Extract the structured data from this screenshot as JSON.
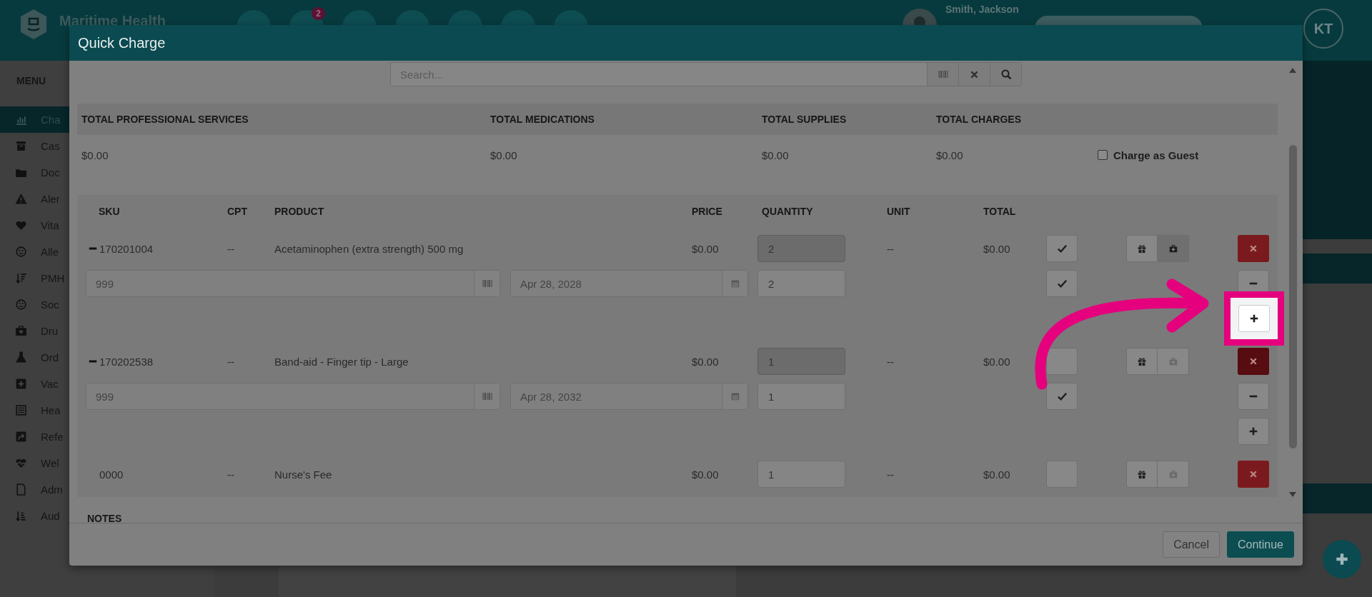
{
  "app_header": {
    "brand": "Maritime Health",
    "notification_badge": "2",
    "patient_name": "Smith, Jackson",
    "user_initials": "KT"
  },
  "sidebar": {
    "title": "MENU",
    "items": [
      {
        "label": "Cha",
        "selected": true
      },
      {
        "label": "Cas",
        "selected": false
      },
      {
        "label": "Doc",
        "selected": false
      },
      {
        "label": "Aler",
        "selected": false
      },
      {
        "label": "Vita",
        "selected": false
      },
      {
        "label": "Alle",
        "selected": false
      },
      {
        "label": "PMH",
        "selected": false
      },
      {
        "label": "Soc",
        "selected": false
      },
      {
        "label": "Dru",
        "selected": false
      },
      {
        "label": "Ord",
        "selected": false
      },
      {
        "label": "Vac",
        "selected": false
      },
      {
        "label": "Hea",
        "selected": false
      },
      {
        "label": "Refe",
        "selected": false
      },
      {
        "label": "Wel",
        "selected": false
      },
      {
        "label": "Adm",
        "selected": false
      },
      {
        "label": "Aud",
        "selected": false
      }
    ]
  },
  "dialog": {
    "title": "Quick Charge",
    "search": {
      "placeholder": "Search..."
    },
    "totals": [
      {
        "label": "TOTAL PROFESSIONAL SERVICES",
        "value": "$0.00"
      },
      {
        "label": "TOTAL MEDICATIONS",
        "value": "$0.00"
      },
      {
        "label": "TOTAL SUPPLIES",
        "value": "$0.00"
      },
      {
        "label": "TOTAL CHARGES",
        "value": "$0.00"
      }
    ],
    "charge_as_guest": {
      "label": "Charge as Guest",
      "checked": false
    },
    "table": {
      "columns": [
        "SKU",
        "CPT",
        "PRODUCT",
        "PRICE",
        "QUANTITY",
        "UNIT",
        "TOTAL"
      ],
      "rows": [
        {
          "expanded": true,
          "sku": "170201004",
          "cpt": "--",
          "product": "Acetaminophen (extra strength) 500 mg",
          "price": "$0.00",
          "quantity": "2",
          "quantity_disabled": true,
          "unit": "--",
          "total": "$0.00",
          "checked": true,
          "kit_selected": true,
          "lots": [
            {
              "lot": "999",
              "expiry": "Apr 28, 2028",
              "quantity": "2",
              "checked": true
            }
          ],
          "add_highlighted": true
        },
        {
          "expanded": true,
          "sku": "170202538",
          "cpt": "--",
          "product": "Band-aid - Finger tip - Large",
          "price": "$0.00",
          "quantity": "1",
          "quantity_disabled": true,
          "unit": "--",
          "total": "$0.00",
          "checked": false,
          "kit_selected": false,
          "lots": [
            {
              "lot": "999",
              "expiry": "Apr 28, 2032",
              "quantity": "1",
              "checked": true
            }
          ],
          "add_highlighted": false
        },
        {
          "expanded": false,
          "sku": "0000",
          "cpt": "--",
          "product": "Nurse's Fee",
          "price": "$0.00",
          "quantity": "1",
          "quantity_disabled": false,
          "unit": "--",
          "total": "$0.00",
          "checked": false,
          "kit_selected": false
        }
      ]
    },
    "notes_label": "NOTES",
    "buttons": [
      {
        "label": "Cancel",
        "kind": "secondary"
      },
      {
        "label": "Continue",
        "kind": "primary"
      }
    ]
  }
}
